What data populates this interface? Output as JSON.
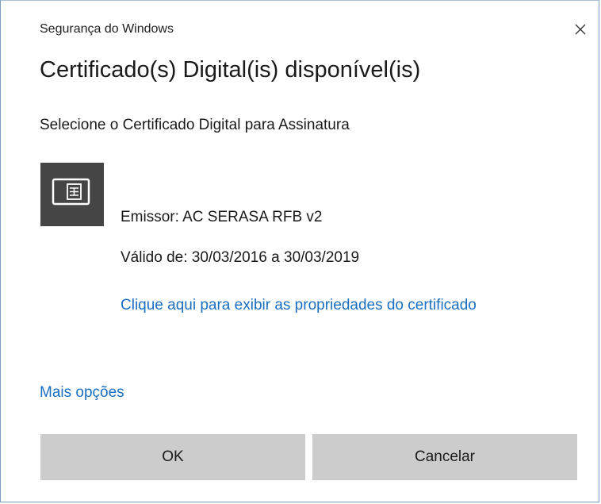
{
  "window": {
    "title": "Segurança do Windows",
    "close_icon": "close-icon"
  },
  "dialog": {
    "heading": "Certificado(s) Digital(is) disponível(is)",
    "instruction": "Selecione o Certificado Digital para Assinatura"
  },
  "certificate": {
    "icon": "certificate-card-icon",
    "issuer": "Emissor: AC SERASA RFB v2",
    "validity": "Válido de: 30/03/2016 a 30/03/2019",
    "properties_link": "Clique aqui para exibir as propriedades do certificado"
  },
  "more_options": "Mais opções",
  "buttons": {
    "ok": "OK",
    "cancel": "Cancelar"
  },
  "background_fragment": "p",
  "colors": {
    "link": "#1a6fc2",
    "button_bg": "#cccccc",
    "tile_bg": "#454545"
  }
}
